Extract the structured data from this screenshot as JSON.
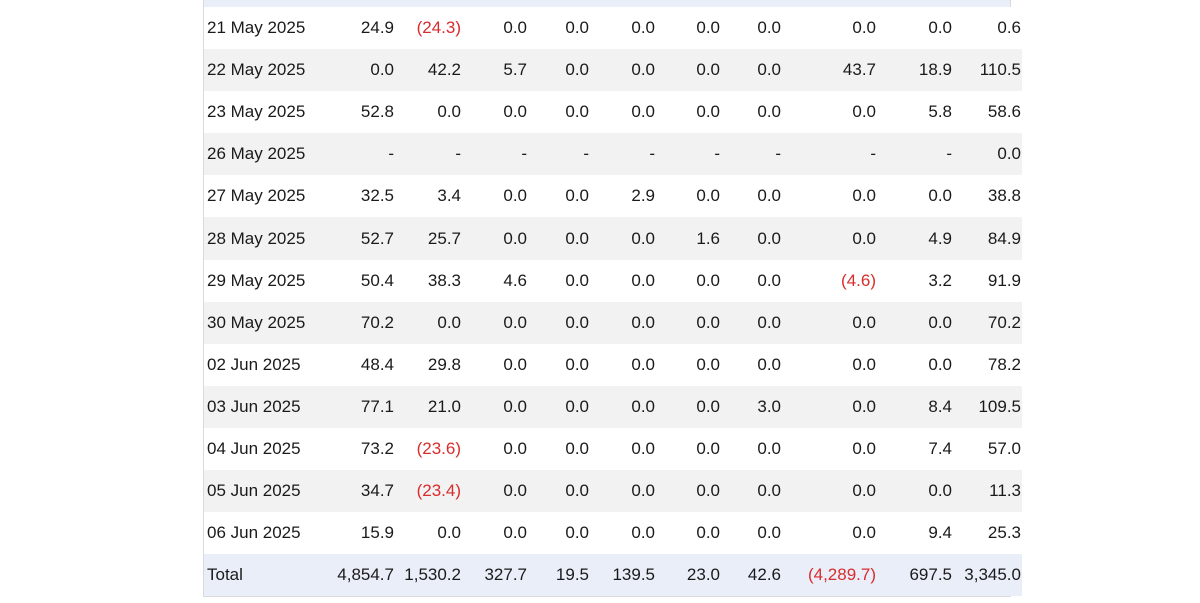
{
  "colors": {
    "negative": "#d92c2c",
    "total_row_bg": "#e9eef8",
    "alt_row_bg": "#f2f2f2"
  },
  "rows": [
    {
      "date": "21 May 2025",
      "values": [
        "24.9",
        "(24.3)",
        "0.0",
        "0.0",
        "0.0",
        "0.0",
        "0.0",
        "0.0",
        "0.0",
        "0.6"
      ]
    },
    {
      "date": "22 May 2025",
      "values": [
        "0.0",
        "42.2",
        "5.7",
        "0.0",
        "0.0",
        "0.0",
        "0.0",
        "43.7",
        "18.9",
        "110.5"
      ]
    },
    {
      "date": "23 May 2025",
      "values": [
        "52.8",
        "0.0",
        "0.0",
        "0.0",
        "0.0",
        "0.0",
        "0.0",
        "0.0",
        "5.8",
        "58.6"
      ]
    },
    {
      "date": "26 May 2025",
      "values": [
        "-",
        "-",
        "-",
        "-",
        "-",
        "-",
        "-",
        "-",
        "-",
        "0.0"
      ]
    },
    {
      "date": "27 May 2025",
      "values": [
        "32.5",
        "3.4",
        "0.0",
        "0.0",
        "2.9",
        "0.0",
        "0.0",
        "0.0",
        "0.0",
        "38.8"
      ]
    },
    {
      "date": "28 May 2025",
      "values": [
        "52.7",
        "25.7",
        "0.0",
        "0.0",
        "0.0",
        "1.6",
        "0.0",
        "0.0",
        "4.9",
        "84.9"
      ]
    },
    {
      "date": "29 May 2025",
      "values": [
        "50.4",
        "38.3",
        "4.6",
        "0.0",
        "0.0",
        "0.0",
        "0.0",
        "(4.6)",
        "3.2",
        "91.9"
      ]
    },
    {
      "date": "30 May 2025",
      "values": [
        "70.2",
        "0.0",
        "0.0",
        "0.0",
        "0.0",
        "0.0",
        "0.0",
        "0.0",
        "0.0",
        "70.2"
      ]
    },
    {
      "date": "02 Jun 2025",
      "values": [
        "48.4",
        "29.8",
        "0.0",
        "0.0",
        "0.0",
        "0.0",
        "0.0",
        "0.0",
        "0.0",
        "78.2"
      ]
    },
    {
      "date": "03 Jun 2025",
      "values": [
        "77.1",
        "21.0",
        "0.0",
        "0.0",
        "0.0",
        "0.0",
        "3.0",
        "0.0",
        "8.4",
        "109.5"
      ]
    },
    {
      "date": "04 Jun 2025",
      "values": [
        "73.2",
        "(23.6)",
        "0.0",
        "0.0",
        "0.0",
        "0.0",
        "0.0",
        "0.0",
        "7.4",
        "57.0"
      ]
    },
    {
      "date": "05 Jun 2025",
      "values": [
        "34.7",
        "(23.4)",
        "0.0",
        "0.0",
        "0.0",
        "0.0",
        "0.0",
        "0.0",
        "0.0",
        "11.3"
      ]
    },
    {
      "date": "06 Jun 2025",
      "values": [
        "15.9",
        "0.0",
        "0.0",
        "0.0",
        "0.0",
        "0.0",
        "0.0",
        "0.0",
        "9.4",
        "25.3"
      ]
    }
  ],
  "total": {
    "label": "Total",
    "values": [
      "4,854.7",
      "1,530.2",
      "327.7",
      "19.5",
      "139.5",
      "23.0",
      "42.6",
      "(4,289.7)",
      "697.5",
      "3,345.0"
    ]
  }
}
